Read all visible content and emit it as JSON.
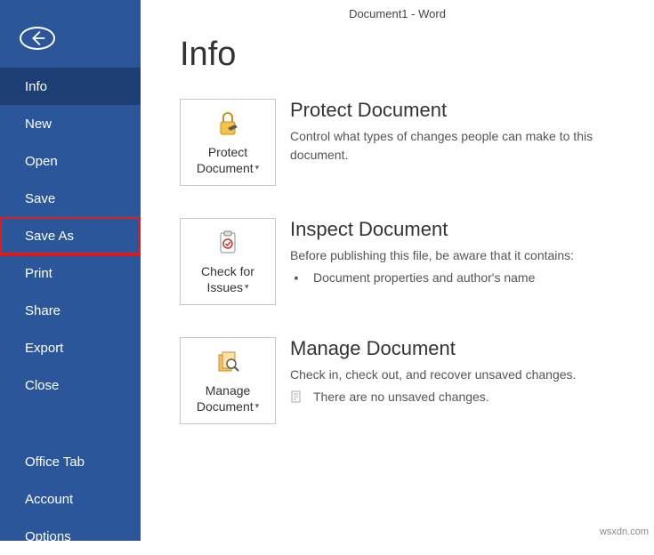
{
  "app": {
    "title": "Document1 - Word"
  },
  "page": {
    "heading": "Info"
  },
  "sidebar": {
    "items": [
      {
        "label": "Info"
      },
      {
        "label": "New"
      },
      {
        "label": "Open"
      },
      {
        "label": "Save"
      },
      {
        "label": "Save As"
      },
      {
        "label": "Print"
      },
      {
        "label": "Share"
      },
      {
        "label": "Export"
      },
      {
        "label": "Close"
      }
    ],
    "footer": [
      {
        "label": "Office Tab"
      },
      {
        "label": "Account"
      },
      {
        "label": "Options"
      }
    ]
  },
  "sections": {
    "protect": {
      "tile_line1": "Protect",
      "tile_line2": "Document",
      "title": "Protect Document",
      "desc": "Control what types of changes people can make to this document."
    },
    "inspect": {
      "tile_line1": "Check for",
      "tile_line2": "Issues",
      "title": "Inspect Document",
      "desc": "Before publishing this file, be aware that it contains:",
      "bullet": "Document properties and author's name"
    },
    "manage": {
      "tile_line1": "Manage",
      "tile_line2": "Document",
      "title": "Manage Document",
      "desc": "Check in, check out, and recover unsaved changes.",
      "bullet": "There are no unsaved changes."
    }
  },
  "watermark": "wsxdn.com"
}
